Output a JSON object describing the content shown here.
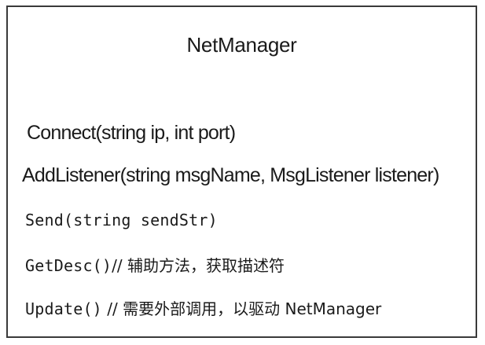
{
  "class": {
    "name": "NetManager",
    "methods": [
      {
        "signature": "Connect(string ip, int port)",
        "comment": ""
      },
      {
        "signature": "AddListener(string msgName, MsgListener listener)",
        "comment": ""
      },
      {
        "signature": "Send(string sendStr)",
        "comment": ""
      },
      {
        "signature": "GetDesc()",
        "comment": "// 辅助方法，获取描述符"
      },
      {
        "signature": "Update()",
        "comment": " // 需要外部调用，以驱动 NetManager"
      }
    ]
  }
}
